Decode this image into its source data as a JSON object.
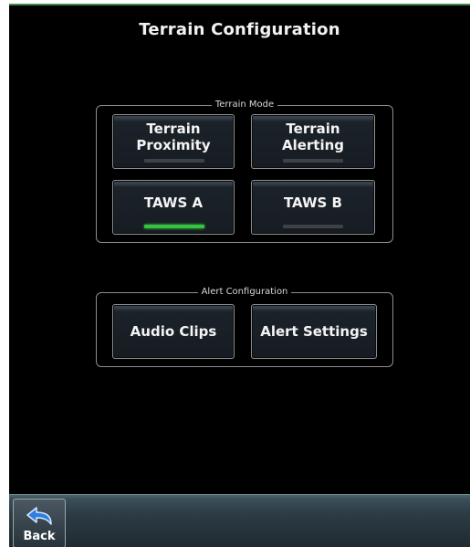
{
  "page": {
    "title": "Terrain Configuration"
  },
  "terrain_mode": {
    "label": "Terrain Mode",
    "buttons": [
      {
        "line1": "Terrain",
        "line2": "Proximity",
        "active": false
      },
      {
        "line1": "Terrain",
        "line2": "Alerting",
        "active": false
      },
      {
        "label": "TAWS A",
        "active": true
      },
      {
        "label": "TAWS B",
        "active": false
      }
    ]
  },
  "alert_configuration": {
    "label": "Alert Configuration",
    "buttons": [
      {
        "label": "Audio Clips"
      },
      {
        "label": "Alert Settings"
      }
    ]
  },
  "bottom_bar": {
    "back_label": "Back",
    "back_icon": "back-arrow-icon"
  },
  "colors": {
    "background": "#000000",
    "indicator_on": "#36c23f",
    "indicator_off": "#3e4246",
    "bar": "#3b5059"
  }
}
